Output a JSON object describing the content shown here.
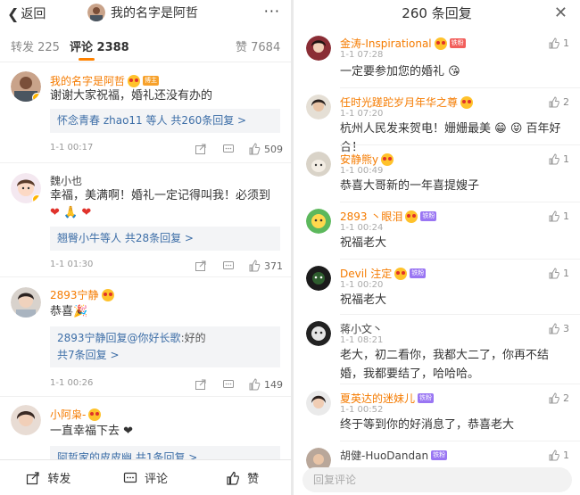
{
  "left": {
    "back_label": "返回",
    "title": "我的名字是阿哲",
    "more": "···",
    "tabs": {
      "forward": "转发 225",
      "comment_label": "评论",
      "comment_count": "2388",
      "like": "赞 7684"
    },
    "comments": [
      {
        "name": "我的名字是阿哲",
        "tag": "博主",
        "text": "谢谢大家祝福，婚礼还没有办的",
        "reply_summary_names": "怀念青春 zhao11 等人",
        "reply_summary_link": "共260条回复 >",
        "time": "1-1 00:17",
        "likes": "509"
      },
      {
        "name": "魏小也",
        "text": "幸福，美满啊！婚礼一定记得叫我！必须到",
        "emoji_line": "❤ 🙏 ❤",
        "reply_summary_names": "翘臀小牛等人",
        "reply_summary_link": "共28条回复 >",
        "time": "1-1 01:30",
        "likes": "371"
      },
      {
        "name": "2893宁静",
        "text": "恭喜🎉",
        "reply_line1_name": "2893宁静回复",
        "reply_line1_mention": "@你好长歌",
        "reply_line1_text": ":好的",
        "reply_summary_link": "共7条回复 >",
        "time": "1-1 00:26",
        "likes": "149"
      },
      {
        "name": "小阿枭-",
        "text": "一直幸福下去 ❤",
        "reply_summary_names": "阿哲家的皮皮幽",
        "reply_summary_link": "共1条回复 >"
      }
    ],
    "bottom": {
      "forward": "转发",
      "comment": "评论",
      "like": "赞"
    }
  },
  "right": {
    "title": "260 条回复",
    "close": "✕",
    "replies": [
      {
        "name": "金涛-Inspirational",
        "tag": "铁粉",
        "time": "1-1 07:28",
        "text": "一定要参加您的婚礼 😘",
        "likes": "1"
      },
      {
        "name": "任时光蹉跎岁月年华之尊",
        "time": "1-1 07:20",
        "text": "杭州人民发来贺电！姗姗最美 😁 😝 百年好合！",
        "likes": "2"
      },
      {
        "name": "安静熊y",
        "time": "1-1 00:49",
        "text": "恭喜大哥新的一年喜提嫂子",
        "likes": "1"
      },
      {
        "name": "2893 丶眼泪",
        "tag": "铁粉",
        "time": "1-1 00:24",
        "text": "祝福老大",
        "likes": "1"
      },
      {
        "name": "Devil 注定",
        "tag": "铁粉",
        "time": "1-1 00:20",
        "text": "祝福老大",
        "likes": "1"
      },
      {
        "name": "蒋小文丶",
        "time": "1-1 08:21",
        "text": "老大，初二看你，我都大二了，你再不结婚，我都要结了，哈哈哈。",
        "likes": "3"
      },
      {
        "name": "夏英达的迷妹儿",
        "tag": "铁粉",
        "time": "1-1 00:52",
        "text": "终于等到你的好消息了，恭喜老大",
        "likes": "2"
      },
      {
        "name": "胡健-HuoDandan",
        "tag": "铁粉",
        "likes": "1"
      }
    ],
    "input_placeholder": "回复评论"
  },
  "colors": {
    "accent": "#ff8200",
    "name_orange": "#f57b00",
    "link_blue": "#3d6ea7"
  }
}
